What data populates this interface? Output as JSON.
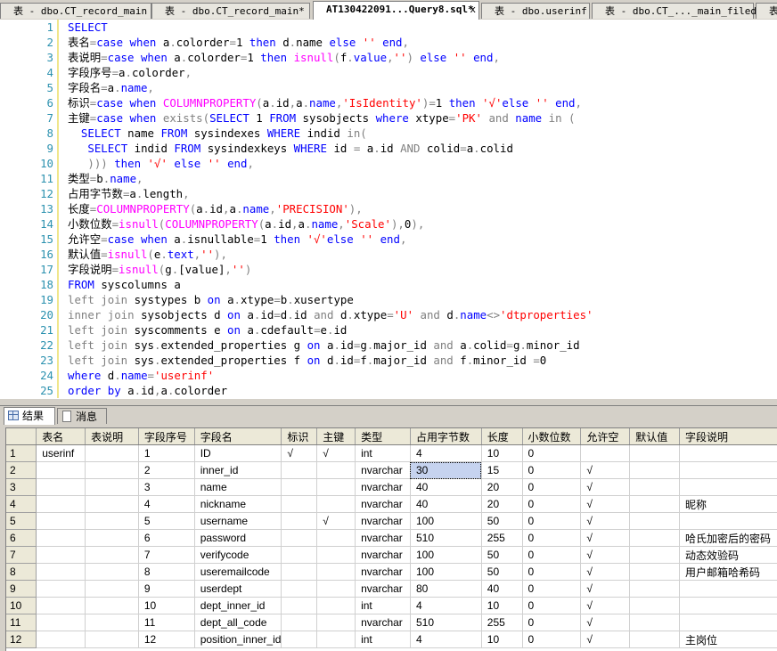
{
  "editor_tabs": [
    {
      "label": "表 - dbo.CT_record_main",
      "active": false
    },
    {
      "label": "表 - dbo.CT_record_main*",
      "active": false
    },
    {
      "label": "AT130422091...Query8.sql*",
      "active": true
    },
    {
      "label": "表 - dbo.userinf",
      "active": false
    },
    {
      "label": "表 - dbo.CT_..._main_filed",
      "active": false
    },
    {
      "label": "表",
      "active": false
    }
  ],
  "close_glyph": "x",
  "code_lines": [
    [
      [
        "kw",
        "SELECT"
      ]
    ],
    [
      [
        "tx",
        "表名"
      ],
      [
        "gr",
        "="
      ],
      [
        "kw",
        "case when "
      ],
      [
        "tx",
        "a"
      ],
      [
        "gr",
        "."
      ],
      [
        "tx",
        "colorder"
      ],
      [
        "gr",
        "="
      ],
      [
        "tx",
        "1 "
      ],
      [
        "kw",
        "then "
      ],
      [
        "tx",
        "d"
      ],
      [
        "gr",
        "."
      ],
      [
        "tx",
        "name "
      ],
      [
        "kw",
        "else "
      ],
      [
        "str",
        "'' "
      ],
      [
        "kw",
        "end"
      ],
      [
        "gr",
        ","
      ]
    ],
    [
      [
        "tx",
        "表说明"
      ],
      [
        "gr",
        "="
      ],
      [
        "kw",
        "case when "
      ],
      [
        "tx",
        "a"
      ],
      [
        "gr",
        "."
      ],
      [
        "tx",
        "colorder"
      ],
      [
        "gr",
        "="
      ],
      [
        "tx",
        "1 "
      ],
      [
        "kw",
        "then "
      ],
      [
        "fn",
        "isnull"
      ],
      [
        "gr",
        "("
      ],
      [
        "tx",
        "f"
      ],
      [
        "gr",
        "."
      ],
      [
        "kw",
        "value"
      ],
      [
        "gr",
        ","
      ],
      [
        "str",
        "''"
      ],
      [
        "gr",
        ") "
      ],
      [
        "kw",
        "else "
      ],
      [
        "str",
        "'' "
      ],
      [
        "kw",
        "end"
      ],
      [
        "gr",
        ","
      ]
    ],
    [
      [
        "tx",
        "字段序号"
      ],
      [
        "gr",
        "="
      ],
      [
        "tx",
        "a"
      ],
      [
        "gr",
        "."
      ],
      [
        "tx",
        "colorder"
      ],
      [
        "gr",
        ","
      ]
    ],
    [
      [
        "tx",
        "字段名"
      ],
      [
        "gr",
        "="
      ],
      [
        "tx",
        "a"
      ],
      [
        "gr",
        "."
      ],
      [
        "kw",
        "name"
      ],
      [
        "gr",
        ","
      ]
    ],
    [
      [
        "tx",
        "标识"
      ],
      [
        "gr",
        "="
      ],
      [
        "kw",
        "case when "
      ],
      [
        "fn",
        "COLUMNPROPERTY"
      ],
      [
        "gr",
        "("
      ],
      [
        "tx",
        "a"
      ],
      [
        "gr",
        "."
      ],
      [
        "tx",
        "id"
      ],
      [
        "gr",
        ","
      ],
      [
        "tx",
        "a"
      ],
      [
        "gr",
        "."
      ],
      [
        "kw",
        "name"
      ],
      [
        "gr",
        ","
      ],
      [
        "str",
        "'IsIdentity'"
      ],
      [
        "gr",
        ")="
      ],
      [
        "tx",
        "1 "
      ],
      [
        "kw",
        "then "
      ],
      [
        "str",
        "'√'"
      ],
      [
        "kw",
        "else "
      ],
      [
        "str",
        "'' "
      ],
      [
        "kw",
        "end"
      ],
      [
        "gr",
        ","
      ]
    ],
    [
      [
        "tx",
        "主键"
      ],
      [
        "gr",
        "="
      ],
      [
        "kw",
        "case when "
      ],
      [
        "gr",
        "exists("
      ],
      [
        "kw",
        "SELECT "
      ],
      [
        "tx",
        "1 "
      ],
      [
        "kw",
        "FROM "
      ],
      [
        "tx",
        "sysobjects "
      ],
      [
        "kw",
        "where "
      ],
      [
        "tx",
        "xtype"
      ],
      [
        "gr",
        "="
      ],
      [
        "str",
        "'PK' "
      ],
      [
        "gr",
        "and "
      ],
      [
        "kw",
        "name "
      ],
      [
        "gr",
        "in ("
      ]
    ],
    [
      [
        "tx",
        "  "
      ],
      [
        "kw",
        "SELECT "
      ],
      [
        "tx",
        "name "
      ],
      [
        "kw",
        "FROM "
      ],
      [
        "tx",
        "sysindexes "
      ],
      [
        "kw",
        "WHERE "
      ],
      [
        "tx",
        "indid "
      ],
      [
        "gr",
        "in("
      ]
    ],
    [
      [
        "tx",
        "   "
      ],
      [
        "kw",
        "SELECT "
      ],
      [
        "tx",
        "indid "
      ],
      [
        "kw",
        "FROM "
      ],
      [
        "tx",
        "sysindexkeys "
      ],
      [
        "kw",
        "WHERE "
      ],
      [
        "tx",
        "id "
      ],
      [
        "gr",
        "= "
      ],
      [
        "tx",
        "a"
      ],
      [
        "gr",
        "."
      ],
      [
        "tx",
        "id "
      ],
      [
        "gr",
        "AND "
      ],
      [
        "tx",
        "colid"
      ],
      [
        "gr",
        "="
      ],
      [
        "tx",
        "a"
      ],
      [
        "gr",
        "."
      ],
      [
        "tx",
        "colid"
      ]
    ],
    [
      [
        "gr",
        "   ))) "
      ],
      [
        "kw",
        "then "
      ],
      [
        "str",
        "'√' "
      ],
      [
        "kw",
        "else "
      ],
      [
        "str",
        "'' "
      ],
      [
        "kw",
        "end"
      ],
      [
        "gr",
        ","
      ]
    ],
    [
      [
        "tx",
        "类型"
      ],
      [
        "gr",
        "="
      ],
      [
        "tx",
        "b"
      ],
      [
        "gr",
        "."
      ],
      [
        "kw",
        "name"
      ],
      [
        "gr",
        ","
      ]
    ],
    [
      [
        "tx",
        "占用字节数"
      ],
      [
        "gr",
        "="
      ],
      [
        "tx",
        "a"
      ],
      [
        "gr",
        "."
      ],
      [
        "tx",
        "length"
      ],
      [
        "gr",
        ","
      ]
    ],
    [
      [
        "tx",
        "长度"
      ],
      [
        "gr",
        "="
      ],
      [
        "fn",
        "COLUMNPROPERTY"
      ],
      [
        "gr",
        "("
      ],
      [
        "tx",
        "a"
      ],
      [
        "gr",
        "."
      ],
      [
        "tx",
        "id"
      ],
      [
        "gr",
        ","
      ],
      [
        "tx",
        "a"
      ],
      [
        "gr",
        "."
      ],
      [
        "kw",
        "name"
      ],
      [
        "gr",
        ","
      ],
      [
        "str",
        "'PRECISION'"
      ],
      [
        "gr",
        "),"
      ]
    ],
    [
      [
        "tx",
        "小数位数"
      ],
      [
        "gr",
        "="
      ],
      [
        "fn",
        "isnull"
      ],
      [
        "gr",
        "("
      ],
      [
        "fn",
        "COLUMNPROPERTY"
      ],
      [
        "gr",
        "("
      ],
      [
        "tx",
        "a"
      ],
      [
        "gr",
        "."
      ],
      [
        "tx",
        "id"
      ],
      [
        "gr",
        ","
      ],
      [
        "tx",
        "a"
      ],
      [
        "gr",
        "."
      ],
      [
        "kw",
        "name"
      ],
      [
        "gr",
        ","
      ],
      [
        "str",
        "'Scale'"
      ],
      [
        "gr",
        "),"
      ],
      [
        "tx",
        "0"
      ],
      [
        "gr",
        "),"
      ]
    ],
    [
      [
        "tx",
        "允许空"
      ],
      [
        "gr",
        "="
      ],
      [
        "kw",
        "case when "
      ],
      [
        "tx",
        "a"
      ],
      [
        "gr",
        "."
      ],
      [
        "tx",
        "isnullable"
      ],
      [
        "gr",
        "="
      ],
      [
        "tx",
        "1 "
      ],
      [
        "kw",
        "then "
      ],
      [
        "str",
        "'√'"
      ],
      [
        "kw",
        "else "
      ],
      [
        "str",
        "'' "
      ],
      [
        "kw",
        "end"
      ],
      [
        "gr",
        ","
      ]
    ],
    [
      [
        "tx",
        "默认值"
      ],
      [
        "gr",
        "="
      ],
      [
        "fn",
        "isnull"
      ],
      [
        "gr",
        "("
      ],
      [
        "tx",
        "e"
      ],
      [
        "gr",
        "."
      ],
      [
        "kw",
        "text"
      ],
      [
        "gr",
        ","
      ],
      [
        "str",
        "''"
      ],
      [
        "gr",
        "),"
      ]
    ],
    [
      [
        "tx",
        "字段说明"
      ],
      [
        "gr",
        "="
      ],
      [
        "fn",
        "isnull"
      ],
      [
        "gr",
        "("
      ],
      [
        "tx",
        "g"
      ],
      [
        "gr",
        "."
      ],
      [
        "tx",
        "[value]"
      ],
      [
        "gr",
        ","
      ],
      [
        "str",
        "''"
      ],
      [
        "gr",
        ")"
      ]
    ],
    [
      [
        "kw",
        "FROM "
      ],
      [
        "tx",
        "syscolumns a"
      ]
    ],
    [
      [
        "gr",
        "left join "
      ],
      [
        "tx",
        "systypes b "
      ],
      [
        "kw",
        "on "
      ],
      [
        "tx",
        "a"
      ],
      [
        "gr",
        "."
      ],
      [
        "tx",
        "xtype"
      ],
      [
        "gr",
        "="
      ],
      [
        "tx",
        "b"
      ],
      [
        "gr",
        "."
      ],
      [
        "tx",
        "xusertype"
      ]
    ],
    [
      [
        "gr",
        "inner join "
      ],
      [
        "tx",
        "sysobjects d "
      ],
      [
        "kw",
        "on "
      ],
      [
        "tx",
        "a"
      ],
      [
        "gr",
        "."
      ],
      [
        "tx",
        "id"
      ],
      [
        "gr",
        "="
      ],
      [
        "tx",
        "d"
      ],
      [
        "gr",
        "."
      ],
      [
        "tx",
        "id "
      ],
      [
        "gr",
        "and "
      ],
      [
        "tx",
        "d"
      ],
      [
        "gr",
        "."
      ],
      [
        "tx",
        "xtype"
      ],
      [
        "gr",
        "="
      ],
      [
        "str",
        "'U' "
      ],
      [
        "gr",
        "and "
      ],
      [
        "tx",
        "d"
      ],
      [
        "gr",
        "."
      ],
      [
        "kw",
        "name"
      ],
      [
        "gr",
        "<>"
      ],
      [
        "str",
        "'dtproperties'"
      ]
    ],
    [
      [
        "gr",
        "left join "
      ],
      [
        "tx",
        "syscomments e "
      ],
      [
        "kw",
        "on "
      ],
      [
        "tx",
        "a"
      ],
      [
        "gr",
        "."
      ],
      [
        "tx",
        "cdefault"
      ],
      [
        "gr",
        "="
      ],
      [
        "tx",
        "e"
      ],
      [
        "gr",
        "."
      ],
      [
        "tx",
        "id"
      ]
    ],
    [
      [
        "gr",
        "left join "
      ],
      [
        "tx",
        "sys"
      ],
      [
        "gr",
        "."
      ],
      [
        "tx",
        "extended_properties g "
      ],
      [
        "kw",
        "on "
      ],
      [
        "tx",
        "a"
      ],
      [
        "gr",
        "."
      ],
      [
        "tx",
        "id"
      ],
      [
        "gr",
        "="
      ],
      [
        "tx",
        "g"
      ],
      [
        "gr",
        "."
      ],
      [
        "tx",
        "major_id "
      ],
      [
        "gr",
        "and "
      ],
      [
        "tx",
        "a"
      ],
      [
        "gr",
        "."
      ],
      [
        "tx",
        "colid"
      ],
      [
        "gr",
        "="
      ],
      [
        "tx",
        "g"
      ],
      [
        "gr",
        "."
      ],
      [
        "tx",
        "minor_id"
      ]
    ],
    [
      [
        "gr",
        "left join "
      ],
      [
        "tx",
        "sys"
      ],
      [
        "gr",
        "."
      ],
      [
        "tx",
        "extended_properties f "
      ],
      [
        "kw",
        "on "
      ],
      [
        "tx",
        "d"
      ],
      [
        "gr",
        "."
      ],
      [
        "tx",
        "id"
      ],
      [
        "gr",
        "="
      ],
      [
        "tx",
        "f"
      ],
      [
        "gr",
        "."
      ],
      [
        "tx",
        "major_id "
      ],
      [
        "gr",
        "and "
      ],
      [
        "tx",
        "f"
      ],
      [
        "gr",
        "."
      ],
      [
        "tx",
        "minor_id "
      ],
      [
        "gr",
        "="
      ],
      [
        "tx",
        "0"
      ]
    ],
    [
      [
        "kw",
        "where "
      ],
      [
        "tx",
        "d"
      ],
      [
        "gr",
        "."
      ],
      [
        "kw",
        "name"
      ],
      [
        "gr",
        "="
      ],
      [
        "str",
        "'userinf'"
      ]
    ],
    [
      [
        "kw",
        "order by "
      ],
      [
        "tx",
        "a"
      ],
      [
        "gr",
        "."
      ],
      [
        "tx",
        "id"
      ],
      [
        "gr",
        ","
      ],
      [
        "tx",
        "a"
      ],
      [
        "gr",
        "."
      ],
      [
        "tx",
        "colorder"
      ]
    ]
  ],
  "result_tabs": [
    {
      "label": "结果",
      "active": true,
      "icon": "grid-icon"
    },
    {
      "label": "消息",
      "active": false,
      "icon": "message-icon"
    }
  ],
  "grid": {
    "columns": [
      "表名",
      "表说明",
      "字段序号",
      "字段名",
      "标识",
      "主键",
      "类型",
      "占用字节数",
      "长度",
      "小数位数",
      "允许空",
      "默认值",
      "字段说明"
    ],
    "rows": [
      [
        "1",
        "userinf",
        "",
        "1",
        "ID",
        "√",
        "√",
        "int",
        "4",
        "10",
        "0",
        "",
        "",
        ""
      ],
      [
        "2",
        "",
        "",
        "2",
        "inner_id",
        "",
        "",
        "nvarchar",
        "30",
        "15",
        "0",
        "√",
        "",
        ""
      ],
      [
        "3",
        "",
        "",
        "3",
        "name",
        "",
        "",
        "nvarchar",
        "40",
        "20",
        "0",
        "√",
        "",
        ""
      ],
      [
        "4",
        "",
        "",
        "4",
        "nickname",
        "",
        "",
        "nvarchar",
        "40",
        "20",
        "0",
        "√",
        "",
        "昵称"
      ],
      [
        "5",
        "",
        "",
        "5",
        "username",
        "",
        "√",
        "nvarchar",
        "100",
        "50",
        "0",
        "√",
        "",
        ""
      ],
      [
        "6",
        "",
        "",
        "6",
        "password",
        "",
        "",
        "nvarchar",
        "510",
        "255",
        "0",
        "√",
        "",
        "哈氏加密后的密码"
      ],
      [
        "7",
        "",
        "",
        "7",
        "verifycode",
        "",
        "",
        "nvarchar",
        "100",
        "50",
        "0",
        "√",
        "",
        "动态效验码"
      ],
      [
        "8",
        "",
        "",
        "8",
        "useremailcode",
        "",
        "",
        "nvarchar",
        "100",
        "50",
        "0",
        "√",
        "",
        "用户邮箱哈希码"
      ],
      [
        "9",
        "",
        "",
        "9",
        "userdept",
        "",
        "",
        "nvarchar",
        "80",
        "40",
        "0",
        "√",
        "",
        ""
      ],
      [
        "10",
        "",
        "",
        "10",
        "dept_inner_id",
        "",
        "",
        "int",
        "4",
        "10",
        "0",
        "√",
        "",
        ""
      ],
      [
        "11",
        "",
        "",
        "11",
        "dept_all_code",
        "",
        "",
        "nvarchar",
        "510",
        "255",
        "0",
        "√",
        "",
        ""
      ],
      [
        "12",
        "",
        "",
        "12",
        "position_inner_id",
        "",
        "",
        "int",
        "4",
        "10",
        "0",
        "√",
        "",
        "主岗位"
      ]
    ]
  }
}
